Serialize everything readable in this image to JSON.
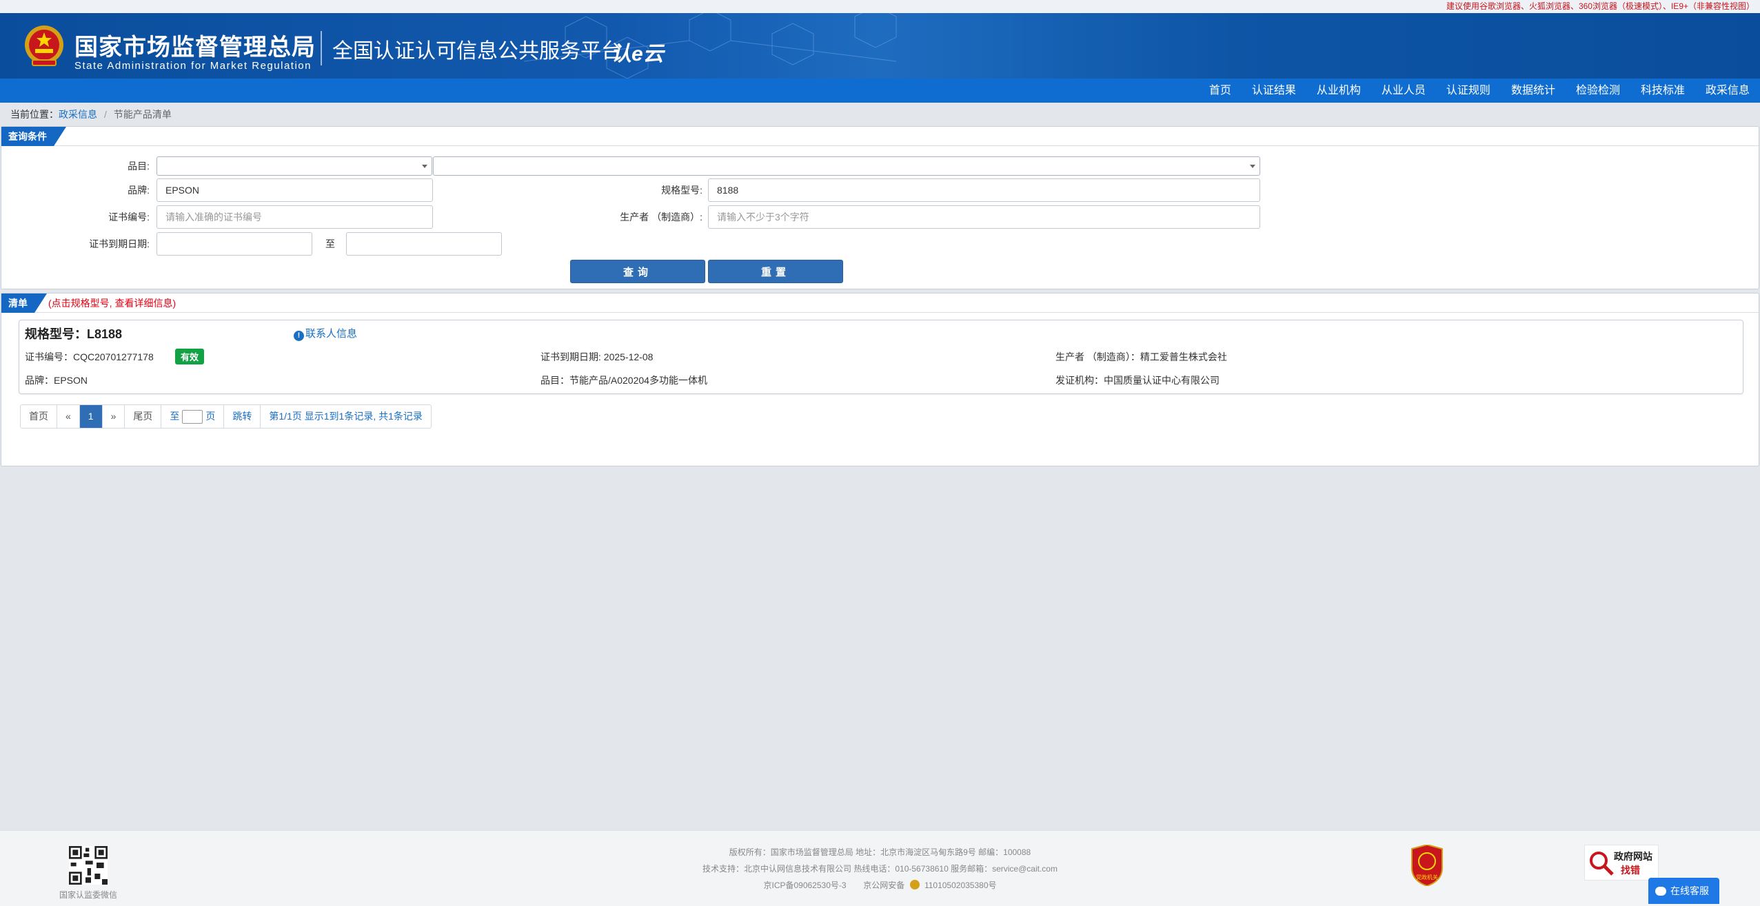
{
  "notice": "建议使用谷歌浏览器、火狐浏览器、360浏览器（极速模式）、IE9+（非兼容性视图）",
  "header": {
    "org_cn": "国家市场监督管理总局",
    "org_en": "State Administration  for  Market Regulation",
    "platform": "全国认证认可信息公共服务平台",
    "logo_text": "认e云"
  },
  "nav": [
    "首页",
    "认证结果",
    "从业机构",
    "从业人员",
    "认证规则",
    "数据统计",
    "检验检测",
    "科技标准",
    "政采信息"
  ],
  "breadcrumb": {
    "prefix": "当前位置：",
    "link": "政采信息",
    "current": "节能产品清单"
  },
  "query": {
    "tag": "查询条件",
    "category_label": "品目:",
    "brand_label": "品牌:",
    "brand_value": "EPSON",
    "model_label": "规格型号:",
    "model_value": "8188",
    "cert_label": "证书编号:",
    "cert_placeholder": "请输入准确的证书编号",
    "maker_label": "生产者 （制造商）:",
    "maker_placeholder": "请输入不少于3个字符",
    "expire_label": "证书到期日期:",
    "to_label": "至",
    "search_btn": "查询",
    "reset_btn": "重置"
  },
  "list": {
    "tag": "清单",
    "tip": "(点击规格型号, 查看详细信息)",
    "items": [
      {
        "model": "规格型号：L8188",
        "contact": "联系人信息",
        "cert_no": "证书编号：CQC20701277178",
        "status": "有效",
        "expire": "证书到期日期: 2025-12-08",
        "maker": "生产者 （制造商）：精工爱普生株式会社",
        "brand": "品牌：EPSON",
        "category": "品目：节能产品/A020204多功能一体机",
        "issuer": "发证机构：中国质量认证中心有限公司"
      }
    ]
  },
  "pager": {
    "first": "首页",
    "prev": "«",
    "page": "1",
    "next": "»",
    "last": "尾页",
    "goto_prefix": "至",
    "goto_suffix": "页",
    "goto_btn": "跳转",
    "summary": "第1/1页  显示1到1条记录, 共1条记录"
  },
  "footer": {
    "line1": "版权所有：国家市场监督管理总局      地址：北京市海淀区马甸东路9号      邮编：100088",
    "line2": "技术支持：北京中认网信息技术有限公司      热线电话：010-56738610      服务邮箱：service@cait.com",
    "line3_a": "京ICP备09062530号-3",
    "line3_b": "京公网安备",
    "line3_c": "11010502035380号",
    "qr_caption": "国家认监委微信",
    "dj_text": "党政机关",
    "gov_text_1": "政府网站",
    "gov_text_2": "找错"
  },
  "chat": "在线客服",
  "colors": {
    "brand": "#0a4d9c",
    "nav": "#0f6dd1",
    "button": "#2f6db4",
    "valid": "#12a145",
    "tip": "#e60012"
  }
}
